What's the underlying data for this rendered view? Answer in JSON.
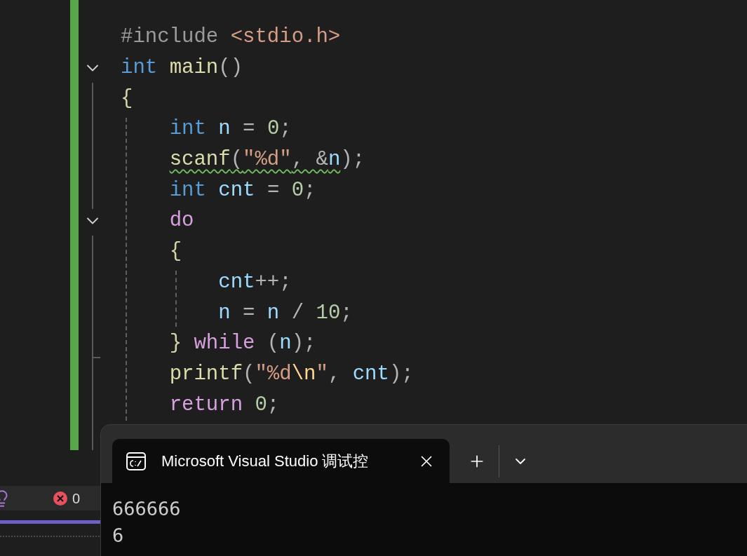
{
  "editor": {
    "lines": [
      {
        "collapsible": false,
        "tokens": [
          {
            "text": "#include ",
            "kind": "preproc",
            "squiggle": false
          },
          {
            "text": "<stdio.h>",
            "kind": "string",
            "squiggle": false
          }
        ]
      },
      {
        "collapsible": true,
        "tokens": [
          {
            "text": "int",
            "kind": "type",
            "squiggle": false
          },
          {
            "text": " main",
            "kind": "func",
            "squiggle": false
          },
          {
            "text": "()",
            "kind": "punct",
            "squiggle": false
          }
        ]
      },
      {
        "collapsible": false,
        "tokens": [
          {
            "text": "{",
            "kind": "brace",
            "squiggle": false
          }
        ]
      },
      {
        "collapsible": false,
        "tokens": [
          {
            "text": "    int",
            "kind": "type",
            "squiggle": false
          },
          {
            "text": " n",
            "kind": "var",
            "squiggle": false
          },
          {
            "text": " = ",
            "kind": "punct",
            "squiggle": false
          },
          {
            "text": "0",
            "kind": "number",
            "squiggle": false
          },
          {
            "text": ";",
            "kind": "punct",
            "squiggle": false
          }
        ]
      },
      {
        "collapsible": false,
        "tokens": [
          {
            "text": "    scanf",
            "kind": "func",
            "squiggle": true
          },
          {
            "text": "(",
            "kind": "punct",
            "squiggle": true
          },
          {
            "text": "\"%d\"",
            "kind": "string",
            "squiggle": true
          },
          {
            "text": ", &",
            "kind": "punct",
            "squiggle": true
          },
          {
            "text": "n",
            "kind": "var",
            "squiggle": true
          },
          {
            "text": ")",
            "kind": "punct",
            "squiggle": false
          },
          {
            "text": ";",
            "kind": "punct",
            "squiggle": false
          }
        ]
      },
      {
        "collapsible": false,
        "tokens": [
          {
            "text": "    int",
            "kind": "type",
            "squiggle": false
          },
          {
            "text": " cnt",
            "kind": "var",
            "squiggle": false
          },
          {
            "text": " = ",
            "kind": "punct",
            "squiggle": false
          },
          {
            "text": "0",
            "kind": "number",
            "squiggle": false
          },
          {
            "text": ";",
            "kind": "punct",
            "squiggle": false
          }
        ]
      },
      {
        "collapsible": true,
        "tokens": [
          {
            "text": "    do",
            "kind": "control",
            "squiggle": false
          }
        ]
      },
      {
        "collapsible": false,
        "tokens": [
          {
            "text": "    {",
            "kind": "brace",
            "squiggle": false
          }
        ]
      },
      {
        "collapsible": false,
        "tokens": [
          {
            "text": "        cnt",
            "kind": "var",
            "squiggle": false
          },
          {
            "text": "++;",
            "kind": "punct",
            "squiggle": false
          }
        ]
      },
      {
        "collapsible": false,
        "tokens": [
          {
            "text": "        n",
            "kind": "var",
            "squiggle": false
          },
          {
            "text": " = ",
            "kind": "punct",
            "squiggle": false
          },
          {
            "text": "n",
            "kind": "var",
            "squiggle": false
          },
          {
            "text": " / ",
            "kind": "punct",
            "squiggle": false
          },
          {
            "text": "10",
            "kind": "number",
            "squiggle": false
          },
          {
            "text": ";",
            "kind": "punct",
            "squiggle": false
          }
        ]
      },
      {
        "collapsible": false,
        "tokens": [
          {
            "text": "    }",
            "kind": "brace",
            "squiggle": false
          },
          {
            "text": " while",
            "kind": "control",
            "squiggle": false
          },
          {
            "text": " (",
            "kind": "punct",
            "squiggle": false
          },
          {
            "text": "n",
            "kind": "var",
            "squiggle": false
          },
          {
            "text": ");",
            "kind": "punct",
            "squiggle": false
          }
        ]
      },
      {
        "collapsible": false,
        "tokens": [
          {
            "text": "    printf",
            "kind": "func",
            "squiggle": false
          },
          {
            "text": "(",
            "kind": "punct",
            "squiggle": false
          },
          {
            "text": "\"%d",
            "kind": "string",
            "squiggle": false
          },
          {
            "text": "\\n",
            "kind": "escape",
            "squiggle": false
          },
          {
            "text": "\"",
            "kind": "string",
            "squiggle": false
          },
          {
            "text": ", ",
            "kind": "punct",
            "squiggle": false
          },
          {
            "text": "cnt",
            "kind": "var",
            "squiggle": false
          },
          {
            "text": ");",
            "kind": "punct",
            "squiggle": false
          }
        ]
      },
      {
        "collapsible": false,
        "tokens": [
          {
            "text": "    return",
            "kind": "control",
            "squiggle": false
          },
          {
            "text": " 0",
            "kind": "number",
            "squiggle": false
          },
          {
            "text": ";",
            "kind": "punct",
            "squiggle": false
          }
        ]
      }
    ]
  },
  "status_bar": {
    "errors": "0"
  },
  "terminal": {
    "tab": {
      "title": "Microsoft Visual Studio 调试控",
      "selected": true
    },
    "output": [
      "666666",
      "6"
    ]
  }
}
